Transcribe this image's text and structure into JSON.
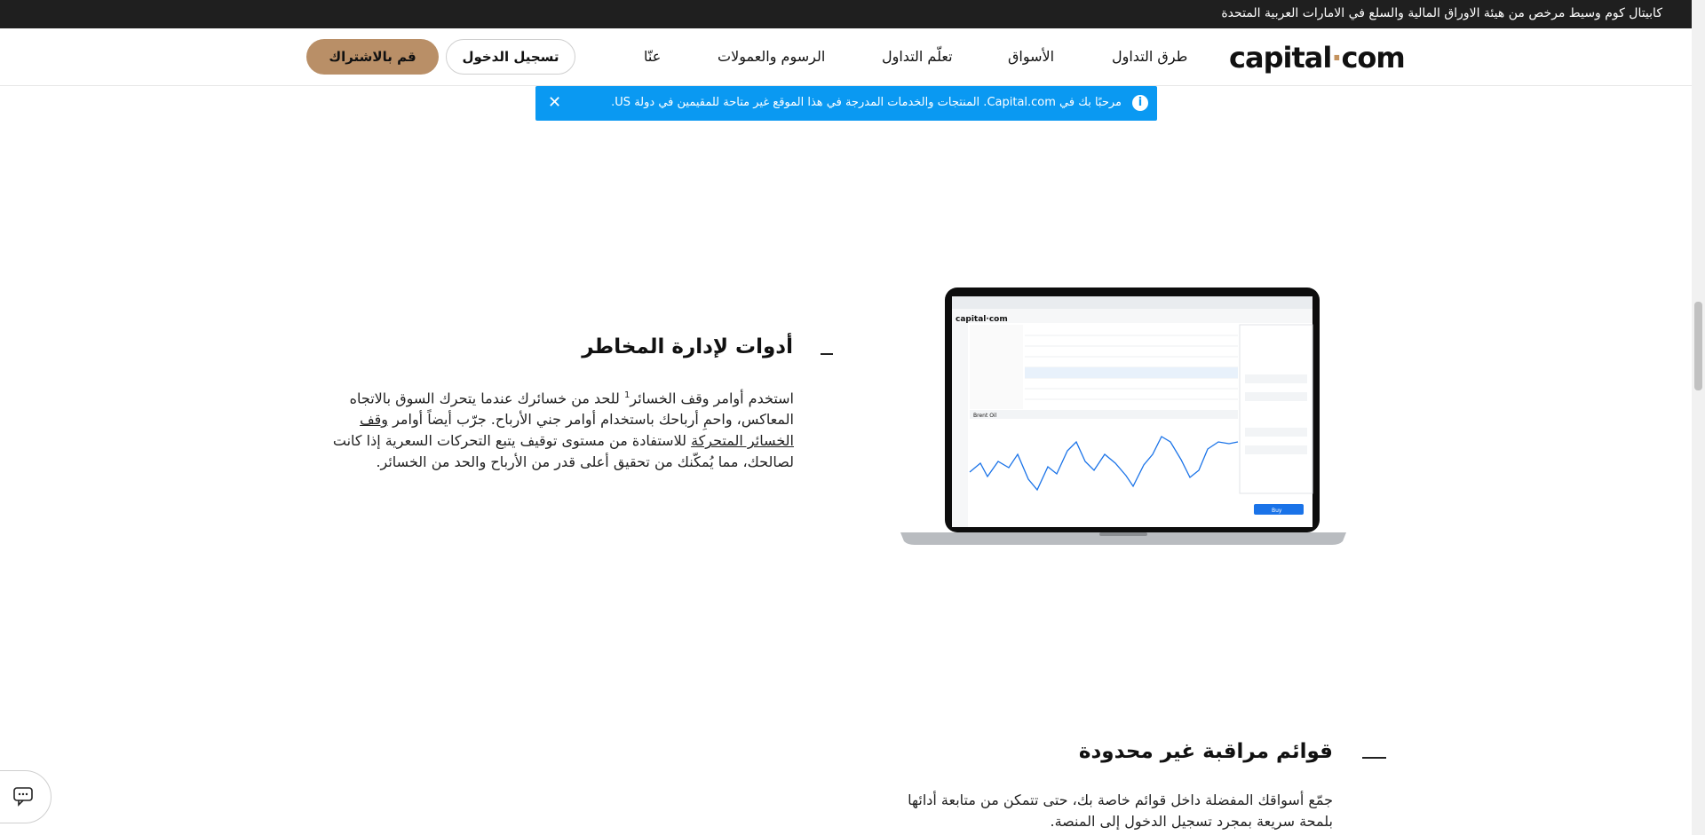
{
  "topbar": {
    "text": "كابيتال كوم وسيط مرخص من هيئة الاوراق المالية والسلع في الامارات العربية المتحدة"
  },
  "nav": {
    "logo": "capital·com",
    "links": [
      "طرق التداول",
      "الأسواق",
      "تعلّم التداول",
      "الرسوم والعمولات",
      "عنّا"
    ],
    "login": "تسجيل الدخول",
    "signup": "قم بالاشتراك"
  },
  "notice": {
    "message": "مرحبًا بك في Capital.com. المنتجات والخدمات المدرجة في هذا الموقع غير متاحة للمقيمين في دولة US.",
    "info_icon": "info-icon",
    "close_icon": "close-icon"
  },
  "section1": {
    "title": "أدوات لإدارة المخاطر",
    "p_before": "استخدم أوامر وقف الخسائر",
    "footnote": "1",
    "p_mid": " للحد من خسائرك عندما يتحرك السوق بالاتجاه المعاكس، واحمِ أرباحك باستخدام أوامر جني الأرباح. جرّب أيضاً أوامر ",
    "link": "وقف الخسائر المتحركة",
    "p_after": " للاستفادة من مستوى توقيف يتبع التحركات السعرية إذا كانت لصالحك، مما يُمكّنك من تحقيق أعلى قدر من الأرباح والحد من الخسائر."
  },
  "laptop": {
    "logo": "capital·com",
    "chart_label": "Brent Oil",
    "buy_label": "Buy"
  },
  "section2": {
    "title": "قوائم مراقبة غير محدودة",
    "text": "جمّع أسواقك المفضلة داخل قوائم خاصة بك، حتى تتمكن من متابعة أدائها بلمحة سريعة بمجرد تسجيل الدخول إلى المنصة."
  },
  "chat": {
    "icon": "chat-icon"
  },
  "colors": {
    "accent": "#b98f67",
    "notice": "#0a99f2",
    "topbar": "#1f1f1f"
  }
}
